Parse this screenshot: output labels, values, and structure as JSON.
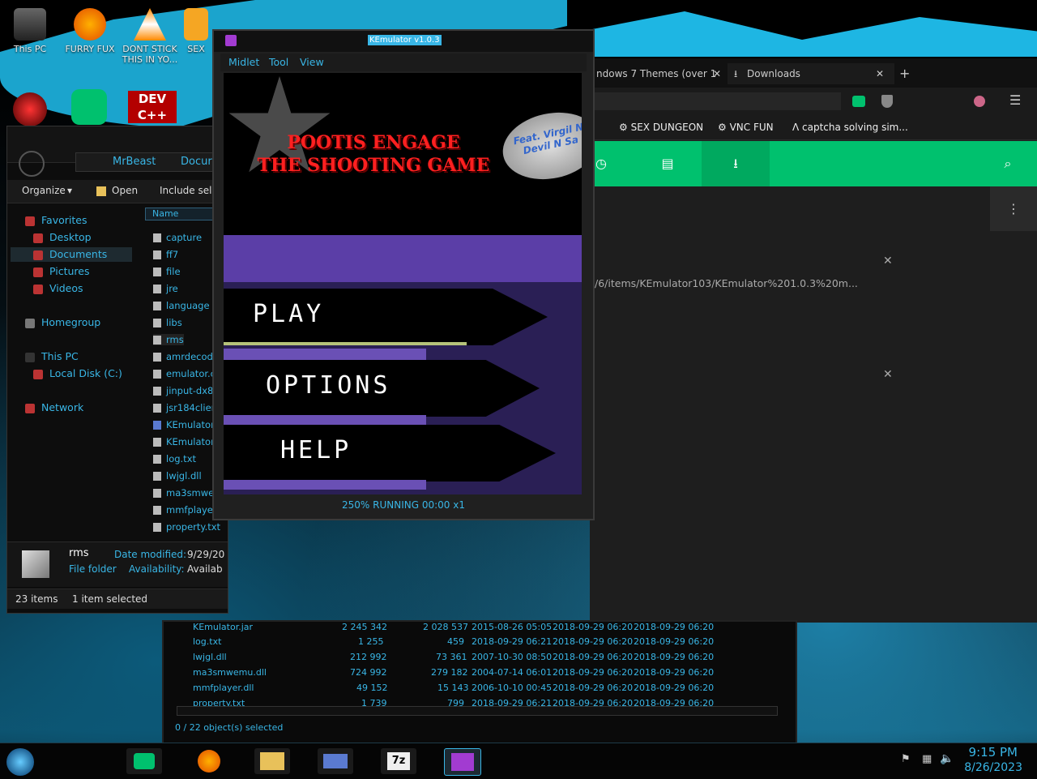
{
  "desktop": {
    "icons": [
      {
        "label": "This PC"
      },
      {
        "label": "FURRY FUX"
      },
      {
        "label": "DONT STICK THIS IN YO..."
      },
      {
        "label": "SEX"
      },
      {
        "label": "DEV C++"
      }
    ]
  },
  "explorer": {
    "breadcrumb": [
      "MrBeast",
      "Docur"
    ],
    "toolbar": {
      "organize": "Organize",
      "open": "Open",
      "include": "Include sele"
    },
    "nav": {
      "favorites": "Favorites",
      "desktop": "Desktop",
      "documents": "Documents",
      "pictures": "Pictures",
      "videos": "Videos",
      "homegroup": "Homegroup",
      "this_pc": "This PC",
      "local_disk": "Local Disk (C:)",
      "network": "Network"
    },
    "column_name": "Name",
    "files": [
      "capture",
      "ff7",
      "file",
      "jre",
      "language",
      "libs",
      "rms",
      "amrdecod",
      "emulator.c",
      "jinput-dx8.",
      "jsr184client",
      "KEmulator",
      "KEmulator",
      "log.txt",
      "lwjgl.dll",
      "ma3smwe",
      "mmfplaye",
      "property.txt"
    ],
    "details": {
      "name": "rms",
      "type": "File folder",
      "date_label": "Date modified:",
      "date_value": "9/29/20",
      "avail_label": "Availability:",
      "avail_value": "Availab"
    },
    "status": {
      "count": "23 items",
      "selected": "1 item selected"
    }
  },
  "browser": {
    "tabs": [
      {
        "label": "ndows 7 Themes (over 1"
      },
      {
        "label": "Downloads"
      }
    ],
    "bookmarks": [
      "SEX DUNGEON",
      "VNC FUN",
      "captcha solving sim..."
    ],
    "download_url": "/6/items/KEmulator103/KEmulator%201.0.3%20m..."
  },
  "zip": {
    "rows": [
      {
        "name": "KEmulator.jar",
        "size": "2 245 342",
        "packed": "2 028 537",
        "modified": "2015-08-26 05:05",
        "created": "2018-09-29 06:20",
        "accessed": "2018-09-29 06:20"
      },
      {
        "name": "log.txt",
        "size": "1 255",
        "packed": "459",
        "modified": "2018-09-29 06:21",
        "created": "2018-09-29 06:20",
        "accessed": "2018-09-29 06:20"
      },
      {
        "name": "lwjgl.dll",
        "size": "212 992",
        "packed": "73 361",
        "modified": "2007-10-30 08:50",
        "created": "2018-09-29 06:20",
        "accessed": "2018-09-29 06:20"
      },
      {
        "name": "ma3smwemu.dll",
        "size": "724 992",
        "packed": "279 182",
        "modified": "2004-07-14 06:01",
        "created": "2018-09-29 06:20",
        "accessed": "2018-09-29 06:20"
      },
      {
        "name": "mmfplayer.dll",
        "size": "49 152",
        "packed": "15 143",
        "modified": "2006-10-10 00:45",
        "created": "2018-09-29 06:20",
        "accessed": "2018-09-29 06:20"
      },
      {
        "name": "property.txt",
        "size": "1 739",
        "packed": "799",
        "modified": "2018-09-29 06:21",
        "created": "2018-09-29 06:20",
        "accessed": "2018-09-29 06:20"
      }
    ],
    "status": "0 / 22 object(s) selected"
  },
  "kemulator": {
    "title": "KEmulator v1.0.3",
    "menu": [
      "Midlet",
      "Tool",
      "View"
    ],
    "game_title_line1": "POOTIS ENGAGE",
    "game_title_line2": "THE SHOOTING GAME",
    "badge_text": "Feat. Virgil N Devil N Sa",
    "menu_items": [
      "PLAY",
      "OPTIONS",
      "HELP"
    ],
    "status": "250%  RUNNING  00:00  x1"
  },
  "taskbar": {
    "time": "9:15 PM",
    "date": "8/26/2023",
    "apps": [
      "start-orb",
      "messages",
      "firefox",
      "explorer",
      "control-panel",
      "7zip",
      "kemulator"
    ]
  },
  "colors": {
    "accent": "#39b6e6",
    "green": "#00c16e",
    "purple": "#5b3ea7",
    "red": "#ff2020"
  }
}
